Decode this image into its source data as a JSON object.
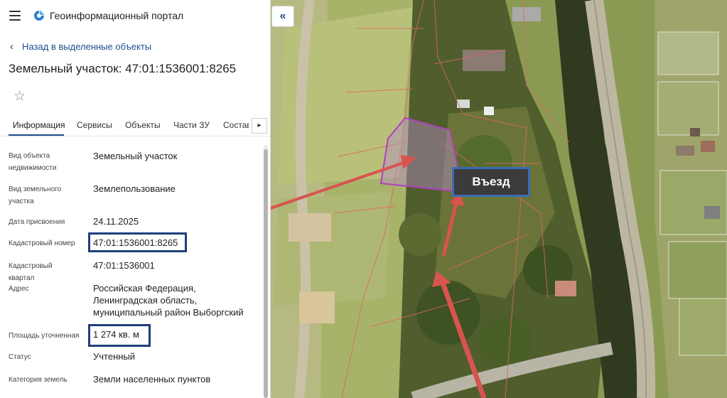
{
  "app": {
    "title": "Геоинформационный портал"
  },
  "nav": {
    "back_label": "Назад в выделенные объекты"
  },
  "page": {
    "title": "Земельный участок: 47:01:1536001:8265"
  },
  "tabs": [
    {
      "label": "Информация"
    },
    {
      "label": "Сервисы"
    },
    {
      "label": "Объекты"
    },
    {
      "label": "Части ЗУ"
    },
    {
      "label": "Состав"
    }
  ],
  "fields": {
    "object_type": {
      "label_line1": "Вид объекта",
      "label_line2": "недвижимости",
      "value": "Земельный участок"
    },
    "land_use": {
      "label_line1": "Вид земельного",
      "label_line2": "участка",
      "value": "Землепользование"
    },
    "assign_date": {
      "label": "Дата присвоения",
      "value": "24.11.2025"
    },
    "cadastral_number": {
      "label": "Кадастровый номер",
      "value": "47:01:1536001:8265"
    },
    "cadastral_quarter": {
      "label": "Кадастровый квартал",
      "value": "47:01:1536001"
    },
    "address": {
      "label": "Адрес",
      "line1": "Российская Федерация,",
      "line2": "Ленинградская область,",
      "line3": "муниципальный район Выборгский"
    },
    "area": {
      "label": "Площадь уточненная",
      "value": "1 274 кв. м"
    },
    "status": {
      "label": "Статус",
      "value": "Учтенный"
    },
    "land_category": {
      "label": "Категория земель",
      "value": "Земли населенных пунктов"
    }
  },
  "map": {
    "entry_label": "Въезд",
    "collapse_icon": "double-chevron-left-icon",
    "parcel_color": "#b23fbf",
    "arrow_color": "#d9534f",
    "highlight_color": "#1f3f7a"
  }
}
